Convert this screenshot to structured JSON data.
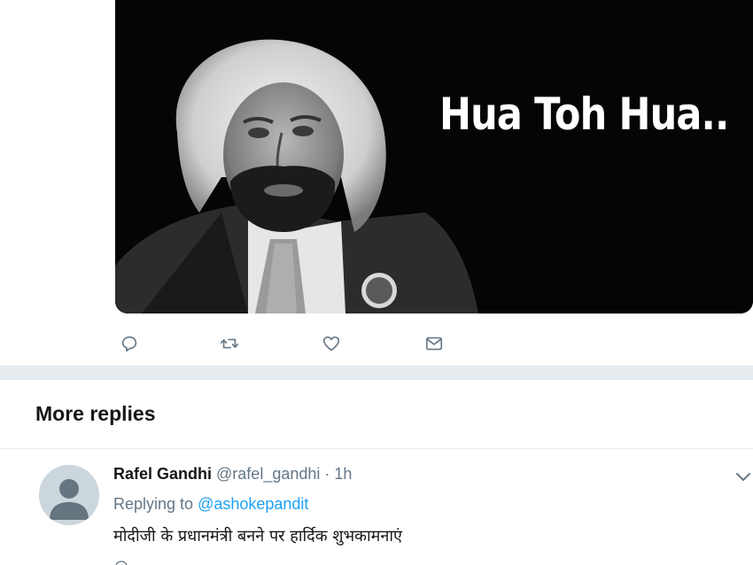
{
  "media": {
    "caption": "Hua Toh Hua.."
  },
  "actions": {
    "reply_icon": "reply-icon",
    "retweet_icon": "retweet-icon",
    "like_icon": "heart-icon",
    "dm_icon": "envelope-icon"
  },
  "section": {
    "title": "More replies"
  },
  "reply": {
    "name": "Rafel Gandhi",
    "handle": "@rafel_gandhi",
    "dot": "·",
    "time": "1h",
    "replying_prefix": "Replying to",
    "replying_to": "@ashokepandit",
    "text": "मोदीजी के प्रधानमंत्री बनने पर हार्दिक शुभकामनाएं"
  },
  "colors": {
    "accent": "#1da1f2",
    "secondary_text": "#657786",
    "icon": "#657786"
  }
}
